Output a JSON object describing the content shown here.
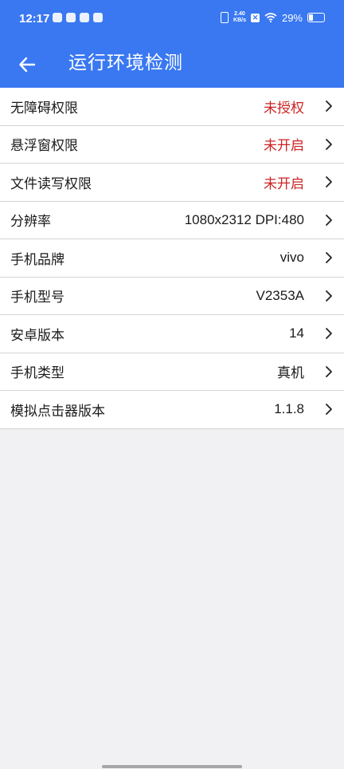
{
  "status_bar": {
    "time": "12:17",
    "net_speed_value": "2.40",
    "net_speed_unit": "KB/s",
    "battery": "29%",
    "sim_mark": "✕"
  },
  "app_bar": {
    "title": "运行环境检测",
    "back_icon": "arrow-left-icon"
  },
  "colors": {
    "primary": "#3a78f2",
    "warning_text": "#cc2424",
    "background": "#f1f1f3"
  },
  "rows": [
    {
      "label": "无障碍权限",
      "value": "未授权",
      "status": "warning"
    },
    {
      "label": "悬浮窗权限",
      "value": "未开启",
      "status": "warning"
    },
    {
      "label": "文件读写权限",
      "value": "未开启",
      "status": "warning"
    },
    {
      "label": "分辨率",
      "value": "1080x2312 DPI:480",
      "status": "normal"
    },
    {
      "label": "手机品牌",
      "value": "vivo",
      "status": "normal"
    },
    {
      "label": "手机型号",
      "value": "V2353A",
      "status": "normal"
    },
    {
      "label": "安卓版本",
      "value": "14",
      "status": "normal"
    },
    {
      "label": "手机类型",
      "value": "真机",
      "status": "normal"
    },
    {
      "label": "模拟点击器版本",
      "value": "1.1.8",
      "status": "normal"
    }
  ]
}
